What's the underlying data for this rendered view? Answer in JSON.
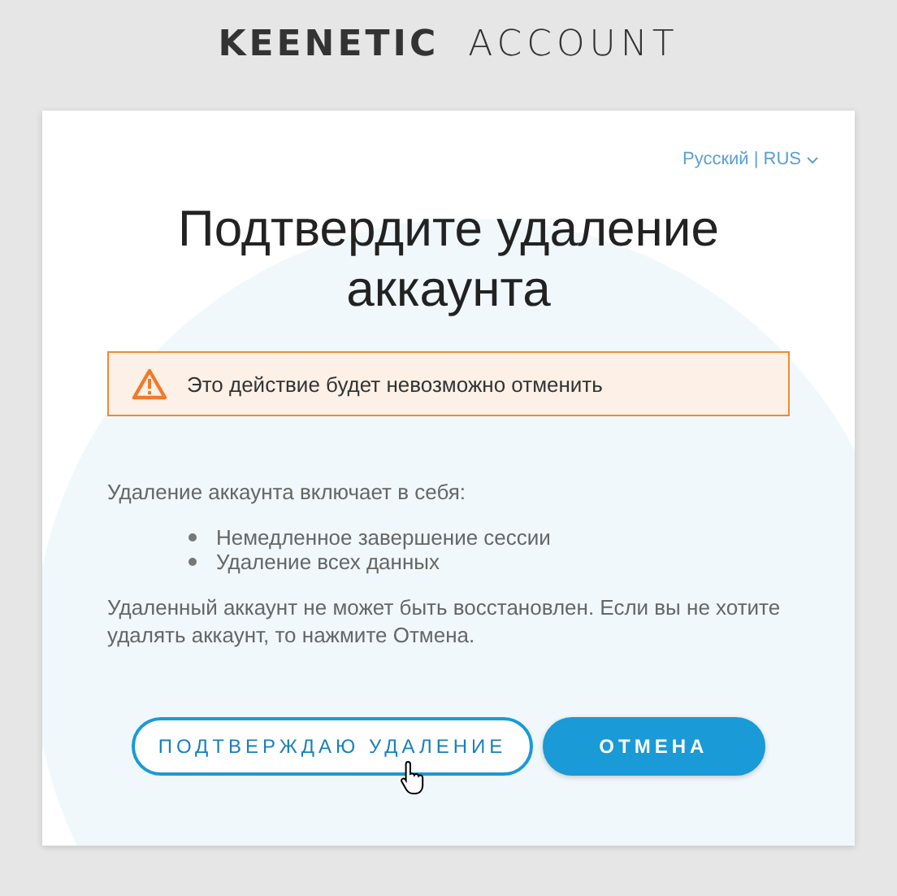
{
  "logo": {
    "brand": "KEENETIC",
    "product": "ACCOUNT"
  },
  "language": "Русский | RUS",
  "title": "Подтвердите удаление аккаунта",
  "warning": "Это действие будет невозможно отменить",
  "intro": "Удаление аккаунта включает в себя:",
  "items": [
    "Немедленное завершение сессии",
    "Удаление всех данных"
  ],
  "note": "Удаленный аккаунт не может быть восстановлен. Если вы не хотите удалять аккаунт, то нажмите Отмена.",
  "buttons": [
    {
      "label": "ПОДТВЕРЖДАЮ УДАЛЕНИЕ",
      "kind": "outline"
    },
    {
      "label": "ОТМЕНА",
      "kind": "primary"
    }
  ]
}
